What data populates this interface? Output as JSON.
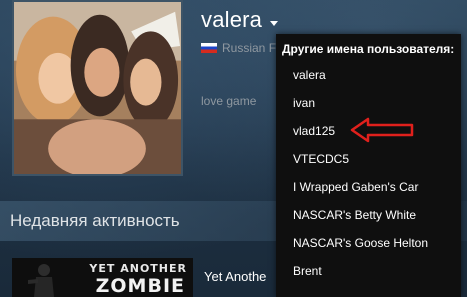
{
  "profile": {
    "username": "valera",
    "country": "Russian F",
    "summary": "love game"
  },
  "alias_dropdown": {
    "header": "Другие имена пользователя:",
    "items": [
      "valera",
      "ivan",
      "vlad125",
      "VTECDC5",
      "I Wrapped Gaben's Car",
      "NASCAR's Betty White",
      "NASCAR's Goose Helton",
      "Brent"
    ]
  },
  "activity": {
    "title": "Недавняя активность",
    "capsule_line1": "YET ANOTHER",
    "capsule_line2": "ZOMBIE",
    "game_name": "Yet Anothe"
  },
  "colors": {
    "background": "#1f3448",
    "dropdown": "#0f0f0f",
    "arrow": "#e0201c"
  },
  "icons": [
    "russia-flag-icon",
    "chevron-down-icon",
    "red-arrow-annotation"
  ]
}
